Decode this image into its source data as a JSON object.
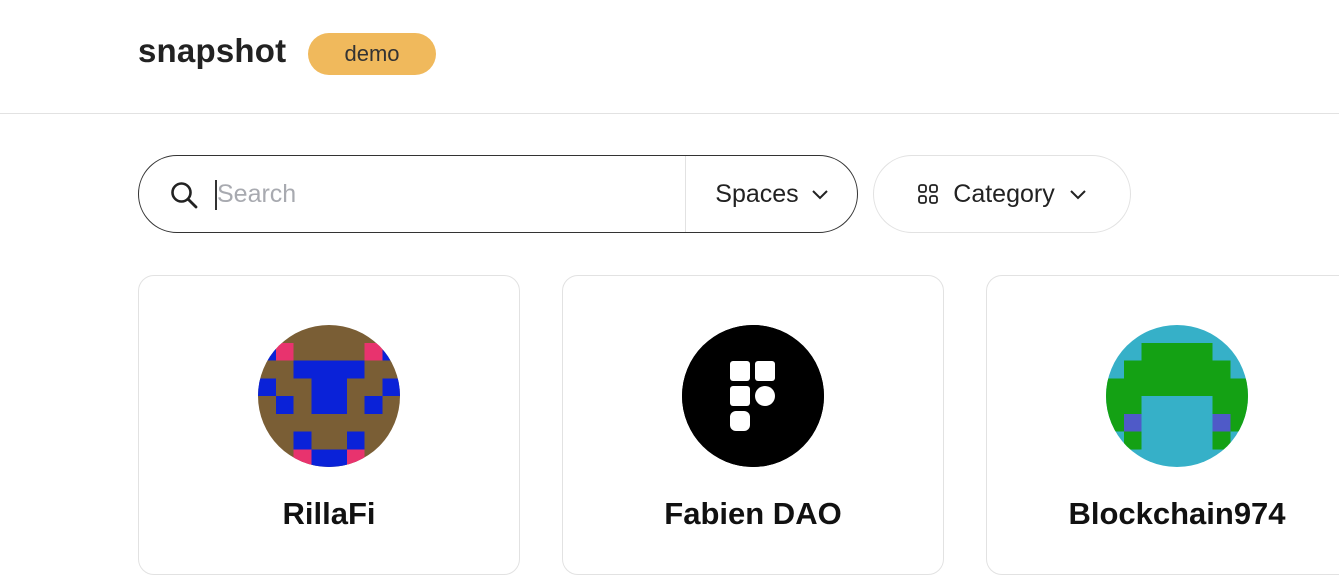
{
  "header": {
    "logo": "snapshot",
    "badge": "demo"
  },
  "search": {
    "placeholder": "Search",
    "value": "",
    "scope_label": "Spaces",
    "search_icon": "search-icon",
    "scope_icon": "chevron-down-icon"
  },
  "category": {
    "label": "Category",
    "icon": "grid-icon",
    "chevron_icon": "chevron-down-icon"
  },
  "spaces": [
    {
      "name": "RillaFi"
    },
    {
      "name": "Fabien DAO"
    },
    {
      "name": "Blockchain974"
    }
  ],
  "colors": {
    "badge_bg": "#f0b95c",
    "border": "#e2e2e2"
  }
}
